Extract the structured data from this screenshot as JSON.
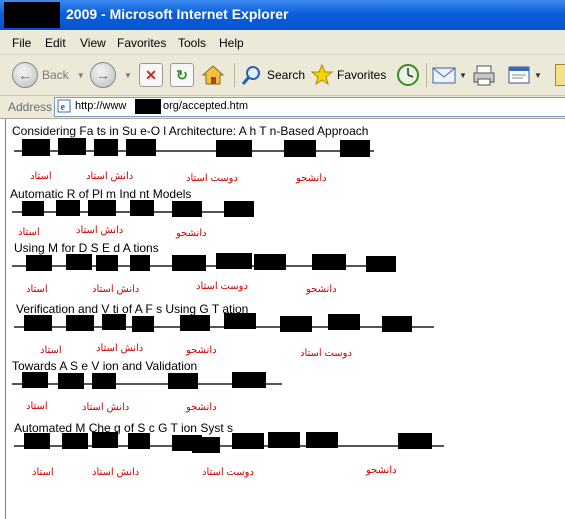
{
  "window": {
    "title": "2009 - Microsoft Internet Explorer"
  },
  "menu": [
    "File",
    "Edit",
    "View",
    "Favorites",
    "Tools",
    "Help"
  ],
  "toolbar": {
    "back": "Back",
    "search": "Search",
    "favorites": "Favorites"
  },
  "address": {
    "label": "Address",
    "url_start": "http://www",
    "url_end": "org/accepted.htm"
  },
  "papers": [
    {
      "title": "Considering Fa  ts in Su    e-O        l Architecture: A       h T                 n-Based Approach"
    },
    {
      "title": "Automatic R          of Pl      m Ind        nt Models"
    },
    {
      "title": "Using M      for D              S     E      d A       tions"
    },
    {
      "title": "Verification and V      ti   of A          F        s Using G        T          ation"
    },
    {
      "title": "Towards A         S        e V                  ion and Validation"
    },
    {
      "title": "Automated M      Che      g of S       c G         T                  ion Syst      s"
    }
  ],
  "annotations": {
    "ostad": "استاد",
    "danesh_ostad": "دانش استاد",
    "doost_ostad": "دوست استاد",
    "daneshjoo": "دانشجو"
  }
}
